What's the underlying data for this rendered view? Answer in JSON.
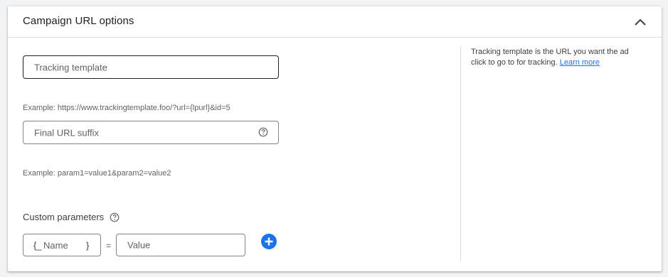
{
  "header": {
    "title": "Campaign URL options",
    "collapse_icon": "chevron-up-icon"
  },
  "tracking_template": {
    "placeholder": "Tracking template",
    "value": "",
    "example": "Example: https://www.trackingtemplate.foo/?url={lpurl}&id=5"
  },
  "final_url_suffix": {
    "placeholder": "Final URL suffix",
    "value": "",
    "help_icon": "help-circle-icon",
    "example": "Example: param1=value1&param2=value2"
  },
  "custom_parameters": {
    "label": "Custom parameters",
    "help_icon": "help-circle-icon",
    "name_open": "{_",
    "name_placeholder": "Name",
    "name_close": "}",
    "equals": "=",
    "value_placeholder": "Value",
    "add_icon": "add-circle-icon"
  },
  "side_help": {
    "text": "Tracking template is the URL you want the ad click to go to for tracking.",
    "link": "Learn more"
  },
  "colors": {
    "accent": "#1a73e8",
    "border": "#80868b",
    "divider": "#dadce0"
  }
}
